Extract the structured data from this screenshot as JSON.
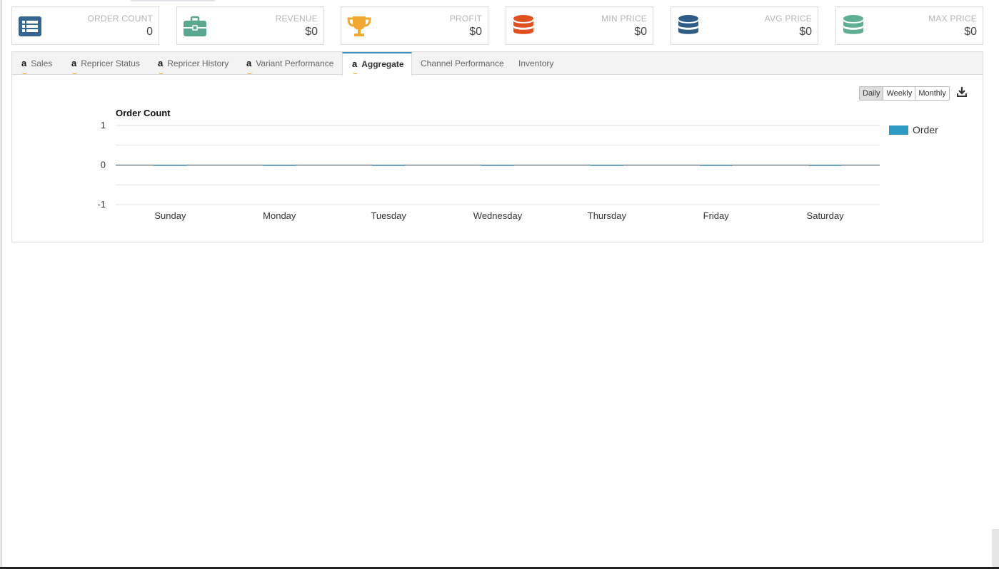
{
  "stats": [
    {
      "label": "ORDER COUNT",
      "value": "0",
      "icon": "list-icon",
      "color": "#356690"
    },
    {
      "label": "REVENUE",
      "value": "$0",
      "icon": "briefcase-icon",
      "color": "#5ba68f"
    },
    {
      "label": "PROFIT",
      "value": "$0",
      "icon": "trophy-icon",
      "color": "#f0a830"
    },
    {
      "label": "MIN PRICE",
      "value": "$0",
      "icon": "database-icon",
      "color": "#e0511f"
    },
    {
      "label": "AVG PRICE",
      "value": "$0",
      "icon": "database-icon",
      "color": "#2e5c87"
    },
    {
      "label": "MAX PRICE",
      "value": "$0",
      "icon": "database-icon",
      "color": "#5fae92"
    }
  ],
  "tabs": [
    {
      "label": "Sales",
      "amazon": true
    },
    {
      "label": "Repricer Status",
      "amazon": true
    },
    {
      "label": "Repricer History",
      "amazon": true
    },
    {
      "label": "Variant Performance",
      "amazon": true
    },
    {
      "label": "Aggregate",
      "amazon": true,
      "active": true
    },
    {
      "label": "Channel Performance",
      "amazon": false
    },
    {
      "label": "Inventory",
      "amazon": false
    }
  ],
  "range": {
    "daily": "Daily",
    "weekly": "Weekly",
    "monthly": "Monthly",
    "selected": "Daily"
  },
  "chart_data": {
    "type": "bar",
    "title": "Order Count",
    "categories": [
      "Sunday",
      "Monday",
      "Tuesday",
      "Wednesday",
      "Thursday",
      "Friday",
      "Saturday"
    ],
    "series": [
      {
        "name": "Order",
        "values": [
          0,
          0,
          0,
          0,
          0,
          0,
          0
        ],
        "color": "#2e9ac4"
      }
    ],
    "ylim": [
      -1,
      1
    ],
    "yticks": [
      1,
      0,
      -1
    ],
    "grid": true,
    "legend": "right"
  }
}
